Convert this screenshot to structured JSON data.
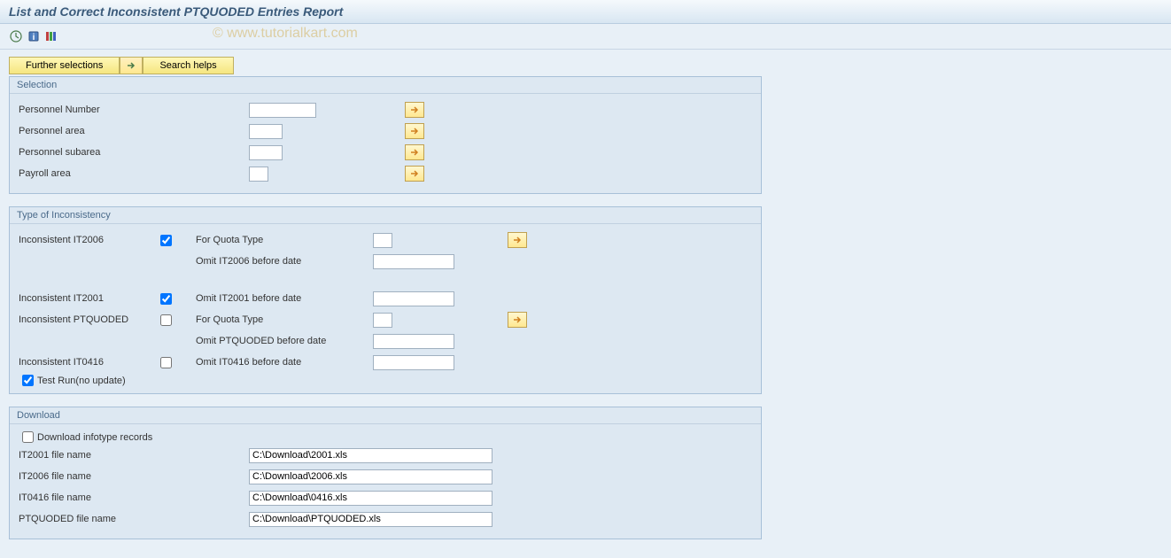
{
  "title": "List and Correct Inconsistent PTQUODED Entries Report",
  "watermark": "© www.tutorialkart.com",
  "toolbar_buttons": {
    "further_selections": "Further selections",
    "search_helps": "Search helps"
  },
  "groups": {
    "selection": {
      "title": "Selection",
      "fields": {
        "personnel_number": "Personnel Number",
        "personnel_area": "Personnel area",
        "personnel_subarea": "Personnel subarea",
        "payroll_area": "Payroll area"
      }
    },
    "inconsistency": {
      "title": "Type of Inconsistency",
      "it2006_label": "Inconsistent IT2006",
      "it2006_checked": true,
      "for_quota_type": "For Quota Type",
      "omit_it2006": "Omit IT2006 before date",
      "it2001_label": "Inconsistent IT2001",
      "it2001_checked": true,
      "omit_it2001": "Omit IT2001 before date",
      "ptquoded_label": "Inconsistent PTQUODED",
      "ptquoded_checked": false,
      "omit_ptquoded": "Omit PTQUODED before date",
      "it0416_label": "Inconsistent IT0416",
      "it0416_checked": false,
      "omit_it0416": "Omit IT0416 before date",
      "test_run": "Test Run(no update)",
      "test_run_checked": true
    },
    "download": {
      "title": "Download",
      "download_records": "Download infotype records",
      "download_checked": false,
      "it2001_label": "IT2001 file name",
      "it2001_value": "C:\\Download\\2001.xls",
      "it2006_label": "IT2006 file name",
      "it2006_value": "C:\\Download\\2006.xls",
      "it0416_label": "IT0416 file name",
      "it0416_value": "C:\\Download\\0416.xls",
      "ptquoded_label": "PTQUODED file name",
      "ptquoded_value": "C:\\Download\\PTQUODED.xls"
    }
  }
}
